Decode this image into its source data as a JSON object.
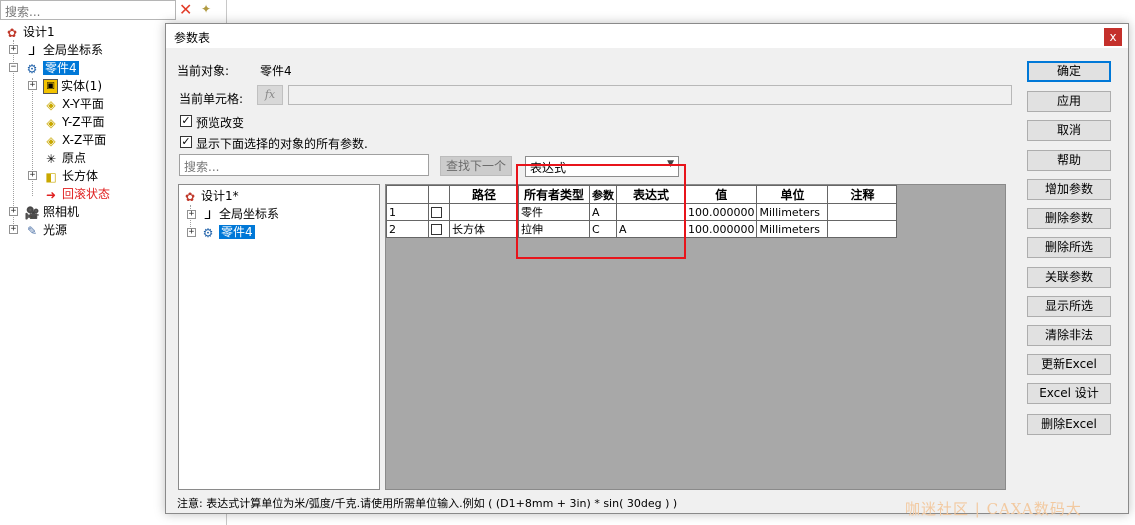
{
  "left_panel": {
    "search_placeholder": "搜索...",
    "tree": [
      {
        "label": "设计1"
      },
      {
        "label": "全局坐标系"
      },
      {
        "label": "零件4"
      },
      {
        "label": "实体(1)"
      },
      {
        "label": "X-Y平面"
      },
      {
        "label": "Y-Z平面"
      },
      {
        "label": "X-Z平面"
      },
      {
        "label": "原点"
      },
      {
        "label": "长方体"
      },
      {
        "label": "回滚状态"
      },
      {
        "label": "照相机"
      },
      {
        "label": "光源"
      }
    ]
  },
  "dialog": {
    "title": "参数表",
    "close_glyph": "x",
    "current_object_label": "当前对象:",
    "current_object_value": "零件4",
    "current_cell_label": "当前单元格:",
    "fx_label": "fx",
    "preview_change_label": "预览改变",
    "show_all_params_label": "显示下面选择的对象的所有参数.",
    "search_placeholder": "搜索...",
    "find_next_label": "查找下一个",
    "expression_combo_value": "表达式",
    "tree": [
      {
        "label": "设计1*"
      },
      {
        "label": "全局坐标系"
      },
      {
        "label": "零件4"
      }
    ],
    "grid": {
      "headers": [
        "",
        "",
        "路径",
        "所有者类型",
        "参数",
        "表达式",
        "值",
        "单位",
        "注释"
      ],
      "rows": [
        {
          "num": "1",
          "path": "",
          "owner_type": "零件",
          "param": "A",
          "expression": "",
          "value": "100.000000",
          "unit": "Millimeters",
          "note": ""
        },
        {
          "num": "2",
          "path": "长方体",
          "owner_type": "拉伸",
          "param": "C",
          "expression": "A",
          "value": "100.000000",
          "unit": "Millimeters",
          "note": ""
        }
      ]
    },
    "note_text": "注意: 表达式计算单位为米/弧度/千克.请使用所需单位输入.例如 ( (D1+8mm + 3in) * sin( 30deg ) )",
    "buttons": {
      "ok": "确定",
      "apply": "应用",
      "cancel": "取消",
      "help": "帮助",
      "add_param": "增加参数",
      "delete_param": "删除参数",
      "delete_selected": "删除所选",
      "link_param": "关联参数",
      "show_selected": "显示所选",
      "clear_invalid": "清除非法",
      "update_excel": "更新Excel",
      "excel_design": "Excel 设计",
      "delete_excel": "删除Excel"
    }
  },
  "watermark": "咖迷社区 | CAXA数码大",
  "colors": {
    "selection": "#0078d7",
    "highlight_box": "#e8141b",
    "rollback_text": "#e02020",
    "dialog_bg": "#f0f0f0"
  }
}
